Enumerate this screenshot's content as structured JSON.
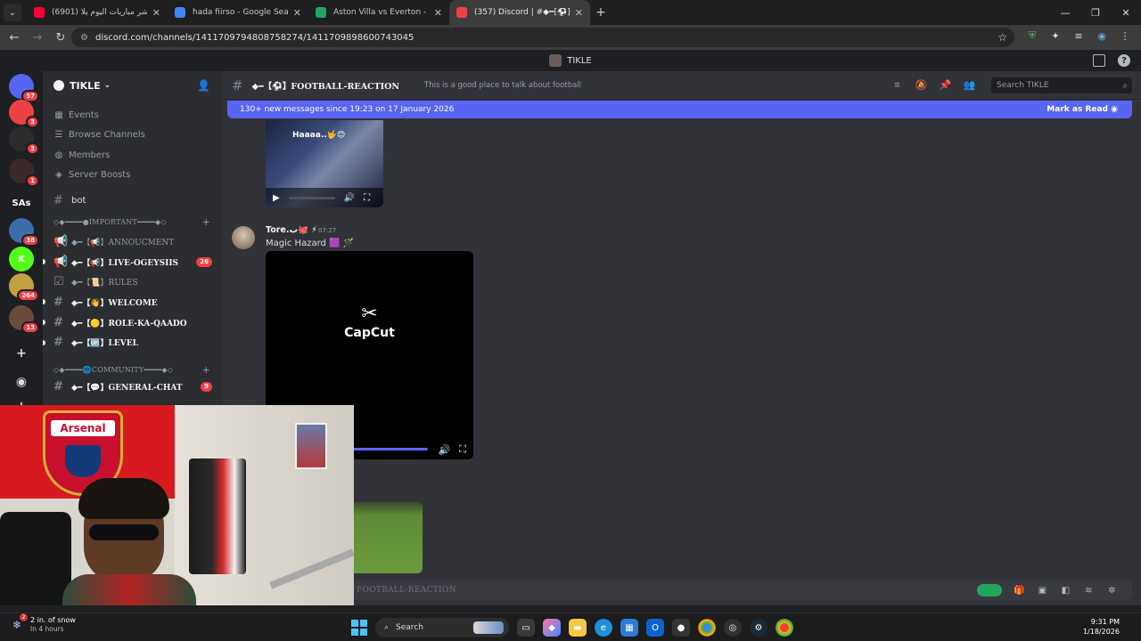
{
  "browser": {
    "tabs": [
      {
        "title": "(6901) بث مباشر مباريات اليوم يلا",
        "favicon_color": "#ff0033",
        "active": false
      },
      {
        "title": "hada fiirso - Google Search",
        "favicon_color": "#4285f4",
        "active": false
      },
      {
        "title": "Aston Villa vs Everton - live score",
        "favicon_color": "#1fa463",
        "active": false
      },
      {
        "title": "(357) Discord | #◆━[⚽]FOOTBALL-",
        "favicon_color": "#ed4245",
        "active": true
      }
    ],
    "url": "discord.com/channels/1411709794808758274/1411709898600743045",
    "close_glyph": "✕",
    "new_tab_glyph": "+"
  },
  "discord": {
    "window_title": "TIKLE",
    "server_name": "TIKLE",
    "rail": [
      {
        "label": "",
        "badge": "57",
        "color": "#5865f2"
      },
      {
        "label": "",
        "badge": "3",
        "color": "#ed4245"
      },
      {
        "label": "",
        "badge": "3",
        "color": "#2b2b2b"
      },
      {
        "label": "",
        "badge": "1",
        "color": "#3a2a2a"
      },
      {
        "label": "SAs",
        "badge": "",
        "color": "#1e1f22"
      },
      {
        "label": "",
        "badge": "38",
        "color": "#3b6ea8"
      },
      {
        "label": "K",
        "badge": "",
        "color": "#53fc18"
      },
      {
        "label": "",
        "badge": "264",
        "color": "#c0a040"
      },
      {
        "label": "",
        "badge": "13",
        "color": "#6a4a3a"
      }
    ],
    "nav": [
      {
        "label": "Events",
        "icon": "calendar-icon",
        "glyph": "▦"
      },
      {
        "label": "Browse Channels",
        "icon": "browse-icon",
        "glyph": "☰"
      },
      {
        "label": "Members",
        "icon": "members-icon",
        "glyph": "◍"
      },
      {
        "label": "Server Boosts",
        "icon": "boost-icon",
        "glyph": "◈"
      }
    ],
    "bot_channel": "bot",
    "category_important": "◇◆━━━━●IMPORTANT━━━━◆◇",
    "channels_important": [
      {
        "name": "◆━【📢】ANNOUCMENT",
        "icon": "📢",
        "unread": false,
        "count": ""
      },
      {
        "name": "◆━【📢】LIVE-OGEYSIIS",
        "icon": "📢",
        "unread": true,
        "count": "26"
      },
      {
        "name": "◆━【📜】RULES",
        "icon": "☑",
        "unread": false,
        "count": ""
      },
      {
        "name": "◆━【👋】WELCOME",
        "icon": "#",
        "unread": true,
        "count": ""
      },
      {
        "name": "◆━【🟡】ROLE-KA-QAADO",
        "icon": "#",
        "unread": true,
        "count": ""
      },
      {
        "name": "◆━【🆙】LEVEL",
        "icon": "#",
        "unread": true,
        "count": ""
      }
    ],
    "category_community": "◇◆━━━━🌐COMMUNITY━━━━◆◇",
    "channel_general": {
      "name": "◆━【💬】GENERAL-CHAT",
      "count": "9"
    },
    "channel_header_name": "◆━【⚽】FOOTBALL-REACTION",
    "channel_topic": "This is a good place to talk about football",
    "search_placeholder": "Search TIKLE",
    "new_messages_bar": "130+ new messages since 19:23 on 17 January 2026",
    "mark_as_read": "Mark as Read",
    "video1_caption": "Haaaa..🤟😊",
    "message": {
      "author": "Tore.ب🐙 ⚡",
      "time": "07:27",
      "text": "Magic Hazard 🟪 🪄"
    },
    "capcut_text": "CapCut",
    "composer_placeholder": "FOOTBALL-REACTION",
    "accent": "#5865f2"
  },
  "webcam": {
    "crest_text": "Arsenal"
  },
  "taskbar": {
    "weather_title": "2 in. of snow",
    "weather_sub": "In 4 hours",
    "weather_badge": "2",
    "search_label": "Search",
    "time": "9:31 PM",
    "date": "1/18/2026"
  }
}
